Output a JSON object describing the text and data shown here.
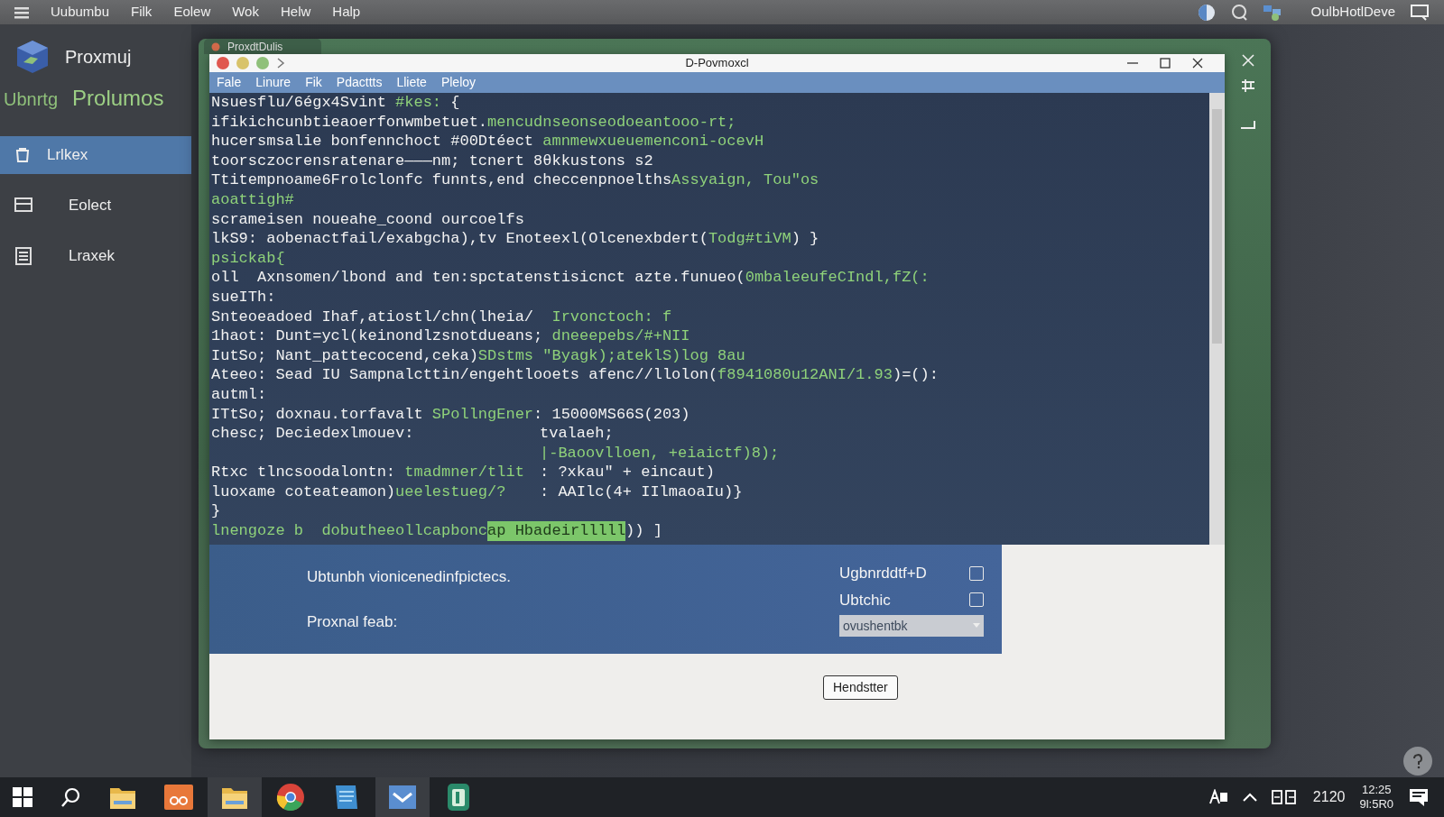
{
  "top_bar": {
    "menu": [
      "Uubumbu",
      "Filk",
      "Eolew",
      "Wok",
      "Helw",
      "Halp"
    ],
    "user": "OulbHotlDeve"
  },
  "sidebar": {
    "brand": "Proxmuj",
    "subtitle_1": "Ubnrtg",
    "subtitle_2": "Prolumos",
    "items": [
      {
        "label": "Lrlkex",
        "selected": true
      },
      {
        "label": "Eolect",
        "selected": false
      },
      {
        "label": "Lraxek",
        "selected": false
      }
    ]
  },
  "back_window": {
    "tab": "ProxdtDulis"
  },
  "window": {
    "title": "D-Povmoxcl",
    "dots": [
      {
        "color": "#e0574f"
      },
      {
        "color": "#d8c36a"
      },
      {
        "color": "#8fc07a"
      }
    ],
    "menu": [
      "Fale",
      "Linure",
      "Fik",
      "Pdacttts",
      "Lliete",
      "Pleloy"
    ]
  },
  "terminal": {
    "lines": [
      {
        "left": [
          {
            "text": "Nsuesflu/6égx4Svint ",
            "kind": "plain"
          },
          {
            "text": "#kes:",
            "kind": "accent"
          },
          {
            "text": " {",
            "kind": "plain"
          }
        ]
      },
      {
        "left": [
          {
            "text": "ifikichcunbtieaoerfonwmbetuet.",
            "kind": "plain"
          },
          {
            "text": "mencudnseonseodoeantooo-rt;",
            "kind": "accent"
          }
        ]
      },
      {
        "left": [
          {
            "text": "hucersmsalie bonfennchoct #00Dtéect ",
            "kind": "plain"
          },
          {
            "text": "amnmewxueuemenconi-ocevH",
            "kind": "accent"
          }
        ]
      },
      {
        "left": [
          {
            "text": "toorsczocrensratenare———nm; tcnert 8θkkustons s2",
            "kind": "plain"
          }
        ]
      },
      {
        "left": [
          {
            "text": "Ttitempnoame6Frolclonfc funnts,end checcenpnoelths",
            "kind": "plain"
          },
          {
            "text": "Assyaign, Tou\"os",
            "kind": "accent"
          }
        ]
      },
      {
        "left": [
          {
            "text": "aoattigh#",
            "kind": "accent"
          }
        ]
      },
      {
        "left": [
          {
            "text": "scrameisen noueahe_coond ourcoelfs",
            "kind": "plain"
          }
        ]
      },
      {
        "left": [
          {
            "text": "lkS9: aobenactfail/exabgcha),tv Enoteexl(Olcenexbdert(",
            "kind": "plain"
          },
          {
            "text": "Todg#tiVM",
            "kind": "accent"
          },
          {
            "text": ") }",
            "kind": "plain"
          }
        ]
      },
      {
        "left": [
          {
            "text": "psickab{",
            "kind": "accent"
          }
        ]
      },
      {
        "left": [
          {
            "text": "oll  Axnsomen/lbond and ten:spctatenstisicnct azte.funueo(",
            "kind": "plain"
          },
          {
            "text": "0mbaleeufeCIndl,fZ(:",
            "kind": "accent"
          }
        ]
      },
      {
        "left": [
          {
            "text": "sueITh:",
            "kind": "plain"
          }
        ]
      },
      {
        "left": [
          {
            "text": "Snteoeadoed Ihaf,atiostl/chn(lheia/  ",
            "kind": "plain"
          },
          {
            "text": "Irvonctoch: f",
            "kind": "accent"
          }
        ]
      },
      {
        "left": [
          {
            "text": "1haot: Dunt=ycl(keinondlzsnotdueans; ",
            "kind": "plain"
          },
          {
            "text": "dneeepebs/#+NII",
            "kind": "accent"
          }
        ]
      },
      {
        "left": [
          {
            "text": "IutSo; Nant_pattecocend,ceka)",
            "kind": "plain"
          },
          {
            "text": "SDstms \"Byagk);ateklS)log 8au",
            "kind": "accent"
          }
        ]
      },
      {
        "left": [
          {
            "text": "Ateeo: Sead IU Sampnalcttin/engehtlooets afenc//llolon(",
            "kind": "plain"
          },
          {
            "text": "f8941080u12ANI/1.93",
            "kind": "accent"
          },
          {
            "text": ")=():",
            "kind": "plain"
          }
        ]
      },
      {
        "left": [
          {
            "text": "autml:",
            "kind": "plain"
          }
        ]
      },
      {
        "left": [
          {
            "text": "ITtSo; doxnau.torfavalt ",
            "kind": "plain"
          },
          {
            "text": "SPollngEner",
            "kind": "accent"
          },
          {
            "text": ": 15000MS66S(203)",
            "kind": "plain"
          }
        ]
      },
      {
        "left": [
          {
            "text": "chesc; Deciedexlmouev:",
            "kind": "plain"
          }
        ],
        "right": [
          {
            "text": "tvalaeh;",
            "kind": "plain"
          }
        ]
      },
      {
        "right": [
          {
            "text": "|-Baoovlloen, ",
            "kind": "accent"
          },
          {
            "text": "+eiaictf)8);",
            "kind": "accent"
          }
        ]
      },
      {
        "left": [
          {
            "text": "Rtxc tlncsoodalontn: ",
            "kind": "plain"
          },
          {
            "text": "tmadmner/tlit",
            "kind": "accent"
          }
        ],
        "right": [
          {
            "text": ": ?xkau\" + eincaut)",
            "kind": "plain"
          }
        ]
      },
      {
        "left": [
          {
            "text": "luoxame coteateamon)",
            "kind": "plain"
          },
          {
            "text": "ueelestueg/?",
            "kind": "accent"
          }
        ],
        "right": [
          {
            "text": ": AAIlc(4+ IIlmaoaIu)}",
            "kind": "plain"
          }
        ]
      },
      {
        "left": [
          {
            "text": "}",
            "kind": "plain"
          }
        ]
      },
      {
        "left": [
          {
            "text": "lnengoze b  dobutheeollcapbonc",
            "kind": "accent"
          },
          {
            "text": "ap Hbadeirlllll",
            "kind": "highlight"
          },
          {
            "text": ")) ]",
            "kind": "plain"
          }
        ]
      }
    ]
  },
  "dialog": {
    "message": "Ubtunbh vionicenedinfpictecs.",
    "field_label": "Proxnal feab:",
    "options": [
      {
        "label": "Ugbnrddtf+D",
        "checked": false
      },
      {
        "label": "Ubtchic",
        "checked": false
      }
    ],
    "select_value": "ovushentbk",
    "button": "Hendstter"
  },
  "taskbar": {
    "apps": [
      {
        "selected": false
      },
      {
        "selected": false
      },
      {
        "selected": true
      },
      {
        "selected": false
      },
      {
        "selected": false
      },
      {
        "selected": true
      },
      {
        "selected": false
      }
    ],
    "tray_number": "2120",
    "time": "12:25",
    "date": "9l:5R0"
  }
}
